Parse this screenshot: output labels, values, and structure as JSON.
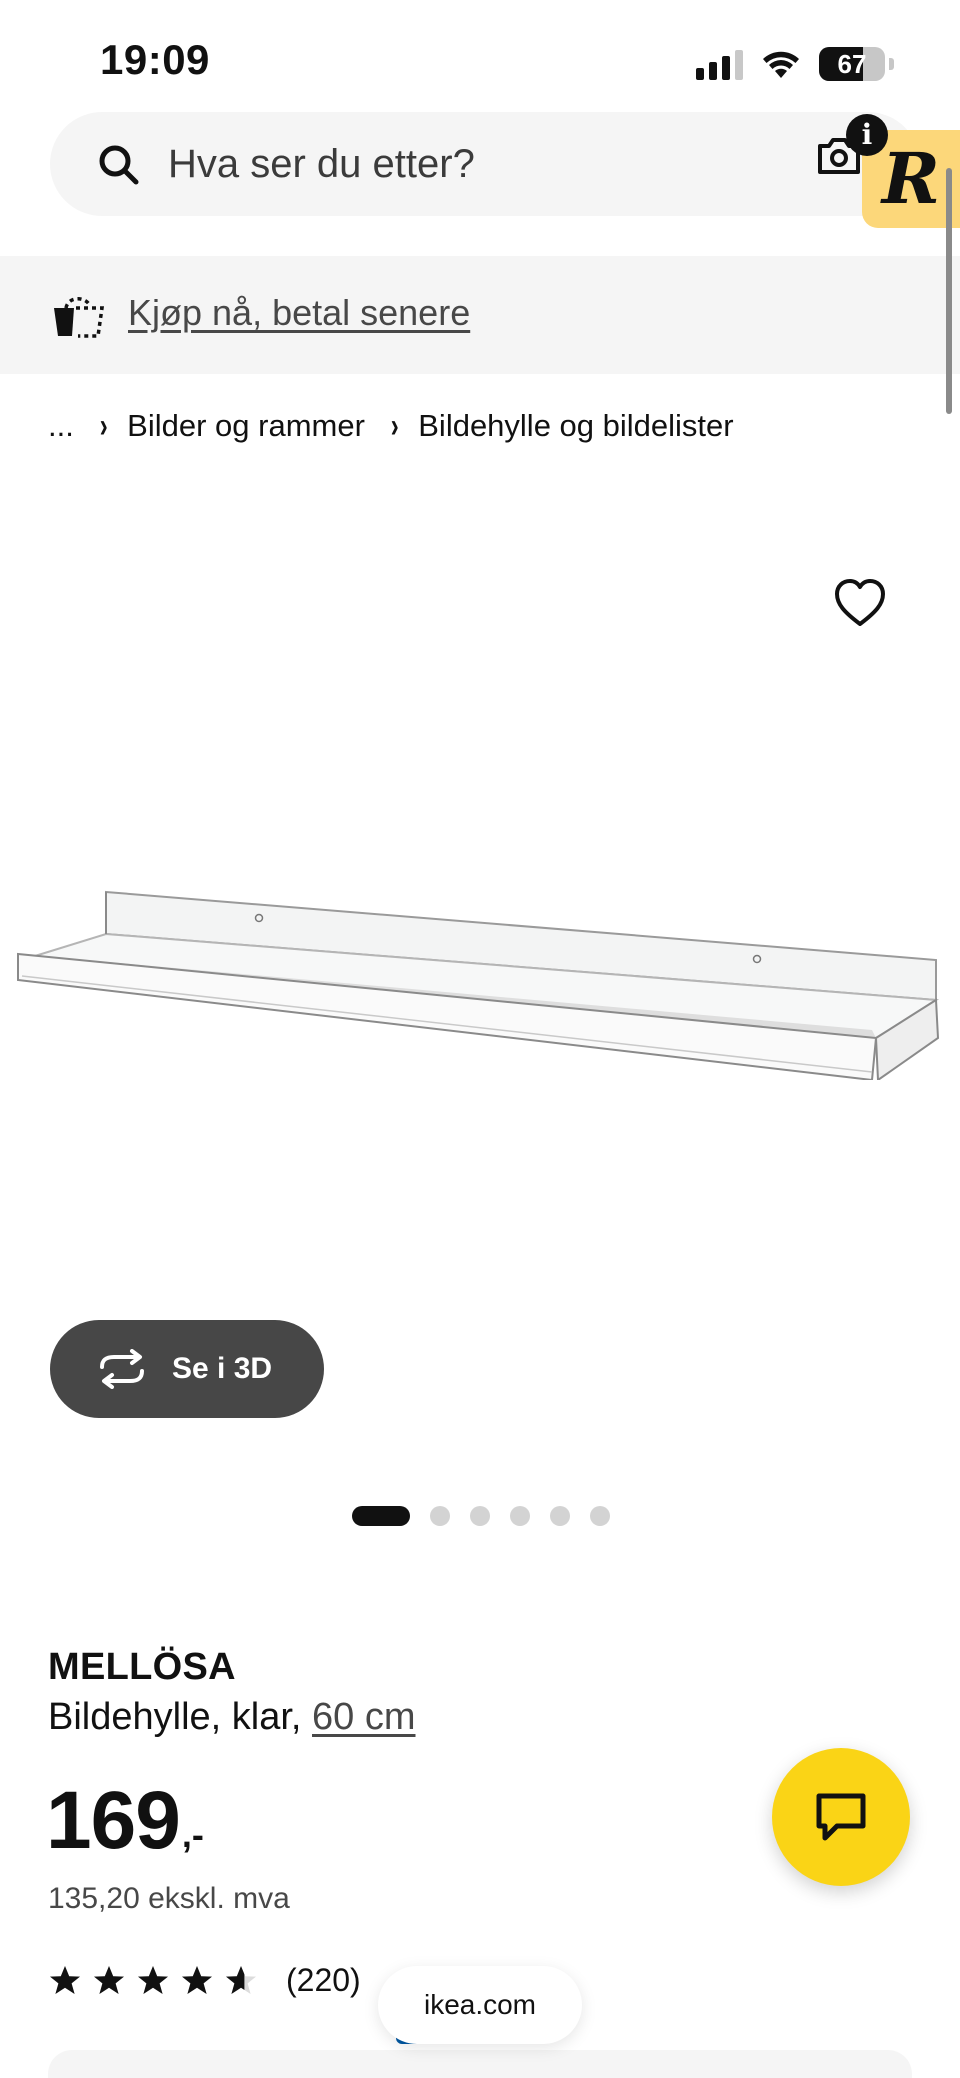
{
  "status_bar": {
    "time": "19:09",
    "battery_percent": 67,
    "battery_label": "67",
    "signal_bars_active": 3,
    "signal_bars_total": 4
  },
  "search": {
    "placeholder": "Hva ser du etter?",
    "value": ""
  },
  "header_icons": {
    "camera": "camera-icon",
    "info": "i",
    "extension_letter": "R"
  },
  "promo": {
    "label": "Kjøp nå, betal senere",
    "icon": "basket-icon"
  },
  "breadcrumb": {
    "ellipsis": "...",
    "separator": "›",
    "items": [
      "Bilder og rammer",
      "Bildehylle og bildelister"
    ]
  },
  "gallery": {
    "view_3d_label": "Se i 3D",
    "total_images": 6,
    "active_index": 0
  },
  "product": {
    "name": "MELLÖSA",
    "description_prefix": "Bildehylle, klar, ",
    "size": "60 cm",
    "price_main": "169",
    "price_suffix": ",-",
    "price_ex_vat": "135,20 ekskl. mva",
    "rating_value": 4.6,
    "rating_max": 5,
    "review_count": "(220)"
  },
  "browser": {
    "url": "ikea.com"
  },
  "colors": {
    "chat_button": "#fad416",
    "extension_badge": "#fcd77a",
    "ikea_blue": "#0058a3",
    "panel_gray": "#f5f5f5",
    "button_dark": "#474747"
  }
}
